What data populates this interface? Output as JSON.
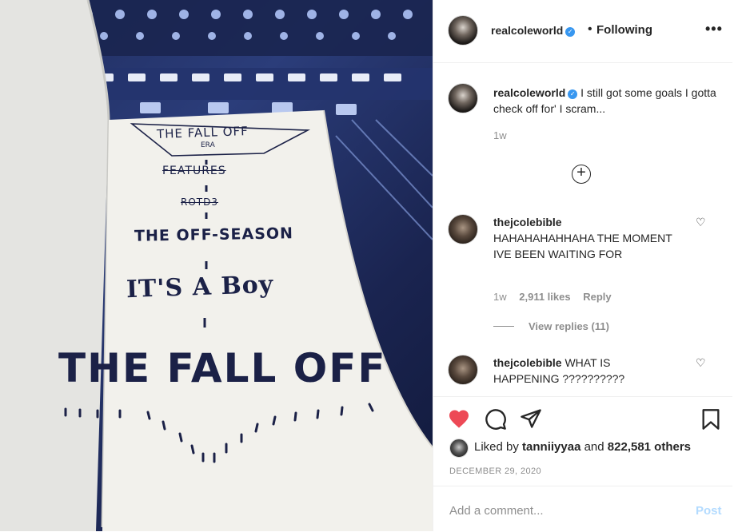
{
  "photo": {
    "notebook_lines": [
      "THE FALL OFF",
      "ERA",
      "FEATURES",
      "ROTD3",
      "THE OFF-SEASON",
      "IT'S A Boy",
      "THE FALL OFF"
    ]
  },
  "header": {
    "username": "realcoleworld",
    "separator": "•",
    "follow_status": "Following",
    "more_icon": "more-dots-icon"
  },
  "caption": {
    "username": "realcoleworld",
    "text": "I still got some goals I gotta check off for' I scram...",
    "time": "1w"
  },
  "load_more_icon": "plus-circle-icon",
  "comments": [
    {
      "username": "thejcolebible",
      "text": "HAHAHAHAHHAHA THE MOMENT IVE BEEN WAITING FOR",
      "time": "1w",
      "likes": "2,911 likes",
      "reply": "Reply",
      "view_replies": "View replies (11)"
    },
    {
      "username": "thejcolebible",
      "text": "WHAT IS HAPPENING ??????????"
    }
  ],
  "actions": {
    "like_icon": "heart-filled-icon",
    "comment_icon": "comment-icon",
    "share_icon": "paper-plane-icon",
    "save_icon": "bookmark-icon",
    "like_color": "#ed4956"
  },
  "likes": {
    "prefix": "Liked by",
    "user": "tanniiyyaa",
    "middle": "and",
    "count": "822,581 others"
  },
  "date": "DECEMBER 29, 2020",
  "comment_input": {
    "placeholder": "Add a comment...",
    "post_label": "Post"
  }
}
